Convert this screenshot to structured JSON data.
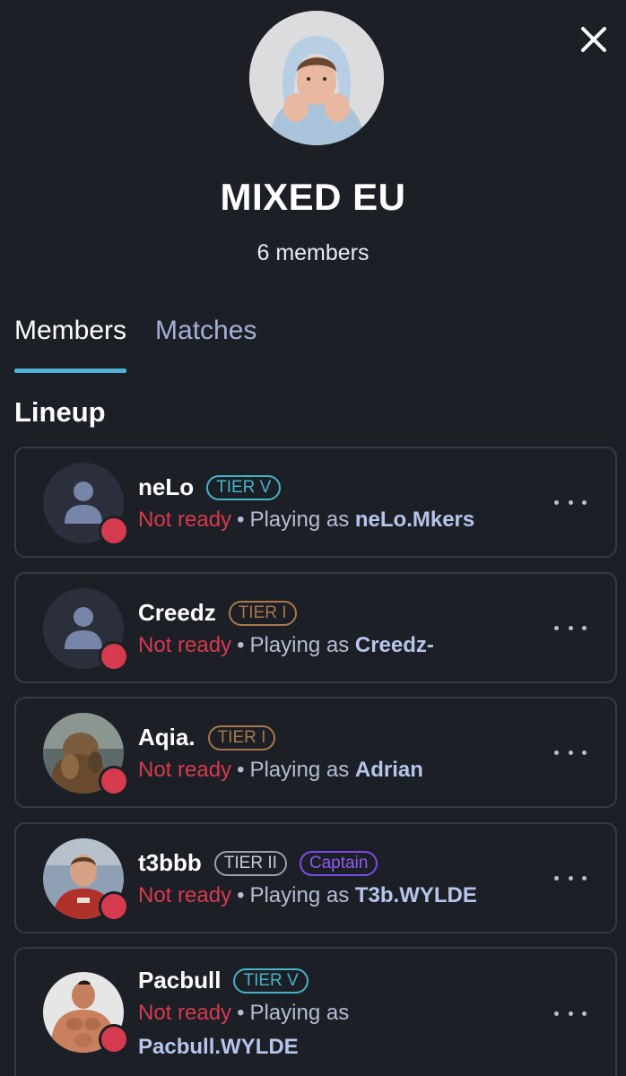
{
  "team": {
    "name": "MIXED EU",
    "member_count": "6 members"
  },
  "tabs": [
    {
      "label": "Members",
      "active": true
    },
    {
      "label": "Matches",
      "active": false
    }
  ],
  "section_title": "Lineup",
  "status_separator": "•",
  "playing_as_prefix": "Playing as",
  "members": [
    {
      "name": "neLo",
      "badges": [
        "TIER V"
      ],
      "status": "Not ready",
      "handle": "neLo.Mkers",
      "avatar": "default-user-icon"
    },
    {
      "name": "Creedz",
      "badges": [
        "TIER I"
      ],
      "status": "Not ready",
      "handle": "Creedz-",
      "avatar": "default-user-icon"
    },
    {
      "name": "Aqia.",
      "badges": [
        "TIER I"
      ],
      "status": "Not ready",
      "handle": "Adrian",
      "avatar": "photo"
    },
    {
      "name": "t3bbb",
      "badges": [
        "TIER II",
        "Captain"
      ],
      "status": "Not ready",
      "handle": "T3b.WYLDE",
      "avatar": "photo"
    },
    {
      "name": "Pacbull",
      "badges": [
        "TIER V"
      ],
      "status": "Not ready",
      "handle": "Pacbull.WYLDE",
      "avatar": "photo"
    }
  ],
  "colors": {
    "background": "#1c1f26",
    "accent": "#4fb3d9",
    "not_ready": "#d63a4e",
    "tier_v": "#46b3c6",
    "tier_i": "#a7784a",
    "captain": "#8a5cf0"
  }
}
